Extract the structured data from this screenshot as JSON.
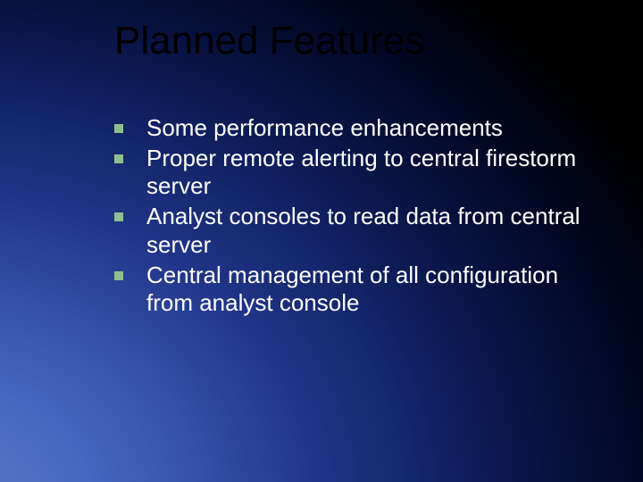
{
  "slide": {
    "title": "Planned Features",
    "bullets": [
      "Some performance enhancements",
      "Proper remote alerting to central firestorm server",
      "Analyst consoles to read data from central server",
      "Central management of all configuration from analyst console"
    ]
  }
}
